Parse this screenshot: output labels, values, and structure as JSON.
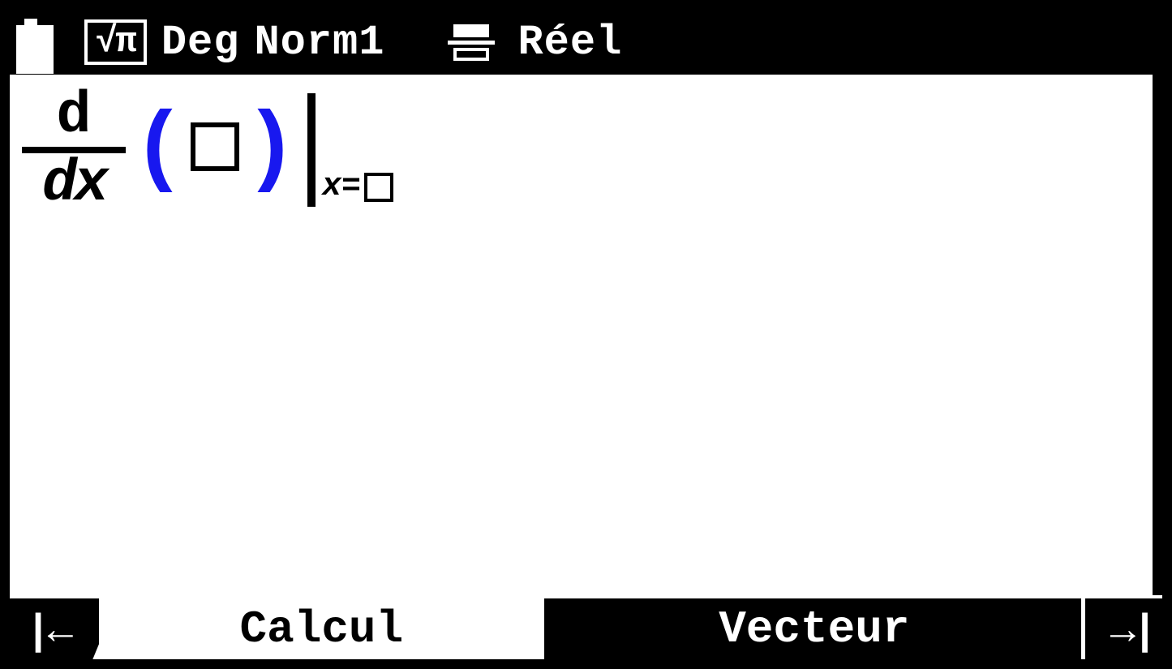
{
  "status": {
    "math_mode": "√π",
    "angle_mode": "Deg",
    "display_mode": "Norm1",
    "number_mode": "Réel"
  },
  "expression": {
    "operator_numerator": "d",
    "operator_denominator": "dx",
    "left_paren": "(",
    "right_paren": ")",
    "eval_var": "x",
    "eval_eq": "="
  },
  "bottom": {
    "left_arrow": "|←",
    "tab1": "Calcul",
    "tab2": "Vecteur",
    "right_arrow": "→|"
  }
}
